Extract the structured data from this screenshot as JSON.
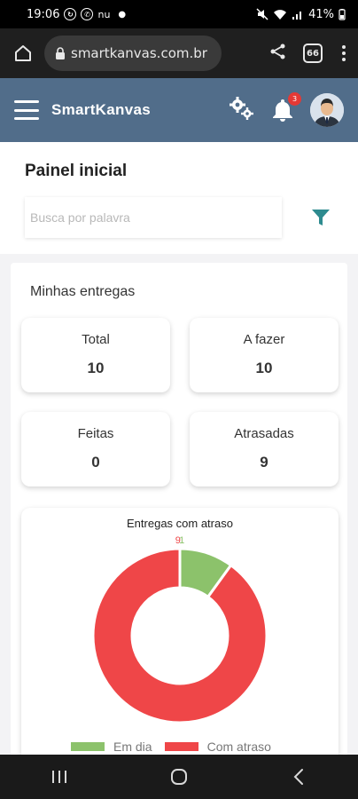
{
  "status_bar": {
    "time": "19:06",
    "battery": "41%",
    "left_icons": [
      "sync-icon",
      "whatsapp-icon",
      "nu-icon"
    ],
    "nu_label": "nu",
    "right_icons": [
      "mute-icon",
      "wifi-icon",
      "signal-icon"
    ]
  },
  "browser": {
    "url": "smartkanvas.com.br",
    "tabs_count": "66"
  },
  "header": {
    "brand": "SmartKanvas",
    "notification_count": "3"
  },
  "main": {
    "title": "Painel inicial",
    "search": {
      "placeholder": "Busca por palavra",
      "value": ""
    },
    "section_title": "Minhas entregas",
    "stats": [
      {
        "label": "Total",
        "value": "10"
      },
      {
        "label": "A fazer",
        "value": "10"
      },
      {
        "label": "Feitas",
        "value": "0"
      },
      {
        "label": "Atrasadas",
        "value": "9"
      }
    ]
  },
  "chart_data": {
    "type": "pie",
    "title": "Entregas com atraso",
    "categories": [
      "Em dia",
      "Com atraso"
    ],
    "values": [
      1,
      9
    ],
    "colors": [
      "#8cc26b",
      "#ef4648"
    ],
    "donut": true,
    "legend_position": "bottom"
  },
  "nav": {
    "buttons": [
      "recent-apps-icon",
      "home-circle-icon",
      "back-icon"
    ]
  }
}
